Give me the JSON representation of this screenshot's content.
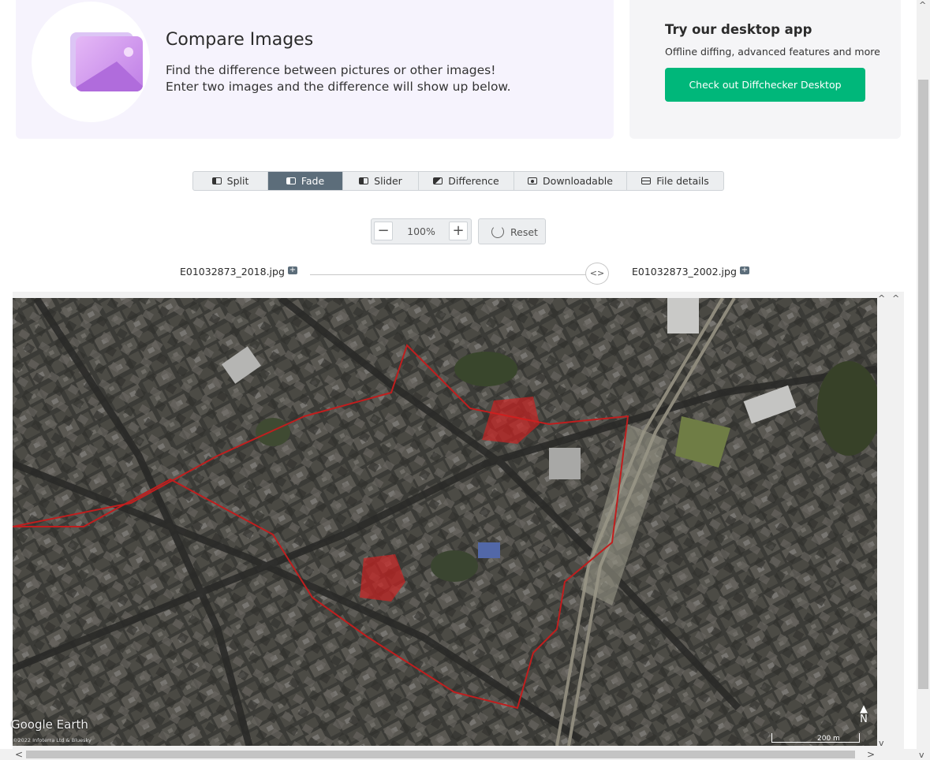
{
  "hero": {
    "title": "Compare Images",
    "line1": "Find the difference between pictures or other images!",
    "line2": "Enter two images and the difference will show up below.",
    "icon": "image-icon"
  },
  "desktop": {
    "title": "Try our desktop app",
    "subtitle": "Offline diffing, advanced features and more",
    "button": "Check out Diffchecker Desktop",
    "button_color": "#00b77a"
  },
  "tabs": [
    {
      "label": "Split",
      "icon": "split-icon",
      "active": false
    },
    {
      "label": "Fade",
      "icon": "fade-icon",
      "active": true
    },
    {
      "label": "Slider",
      "icon": "slider-icon",
      "active": false
    },
    {
      "label": "Difference",
      "icon": "difference-icon",
      "active": false
    },
    {
      "label": "Downloadable",
      "icon": "download-icon",
      "active": false
    },
    {
      "label": "File details",
      "icon": "file-details-icon",
      "active": false
    }
  ],
  "zoom": {
    "value": "100%",
    "minus": "−",
    "plus": "+",
    "reset": "Reset"
  },
  "files": {
    "left": "E01032873_2018.jpg",
    "right": "E01032873_2002.jpg",
    "slider_handle": "<>",
    "fade_position": 1.0
  },
  "map": {
    "watermark": "Google Earth",
    "copyright": "©2022 Infoterra Ltd & Bluesky",
    "north": "N",
    "scale": "200 m",
    "highlight_color": "#d62020"
  },
  "scroll": {
    "up": "^",
    "down": "v",
    "left": "<",
    "right": ">"
  }
}
